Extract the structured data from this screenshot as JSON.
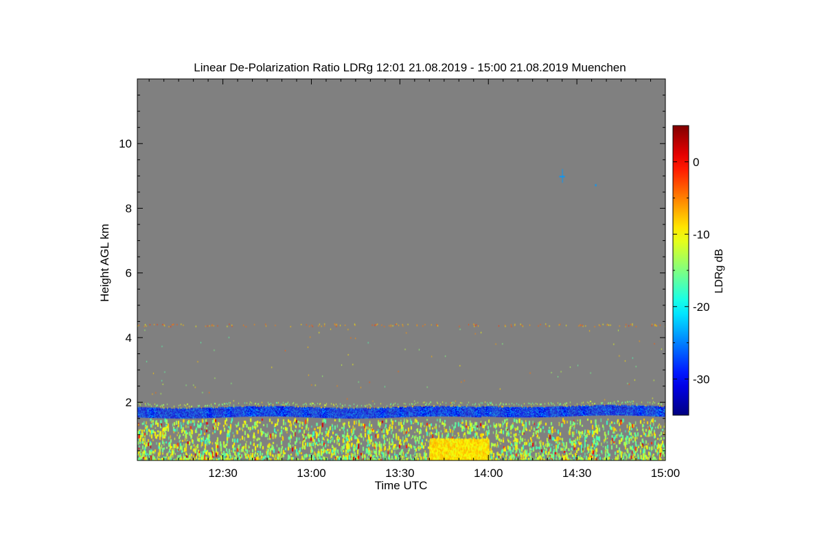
{
  "chart_data": {
    "type": "heatmap",
    "title": "Linear De-Polarization Ratio LDRg   12:01 21.08.2019 - 15:00 21.08.2019 Muenchen",
    "xlabel": "Time UTC",
    "ylabel": "Height AGL km",
    "x_range": [
      "12:01",
      "15:00"
    ],
    "x_ticks": [
      "12:30",
      "13:00",
      "13:30",
      "14:00",
      "14:30",
      "15:00"
    ],
    "y_range": [
      0.2,
      12.0
    ],
    "y_ticks": [
      "2",
      "4",
      "6",
      "8",
      "10"
    ],
    "colorbar": {
      "label": "LDRg dB",
      "range": [
        -35,
        5
      ],
      "ticks": [
        "0",
        "-10",
        "-20",
        "-30"
      ],
      "colormap": "jet"
    },
    "background_color": "#808080",
    "features": {
      "cloud_layer": {
        "base_km": 1.55,
        "top_km": 1.85,
        "ldr_db": -28
      },
      "boundary_layer": {
        "top_km": 1.5,
        "ldr_db": -13
      },
      "strong_echo_patch": {
        "time_start": "13:40",
        "time_end": "14:00",
        "top_km": 0.9,
        "ldr_db": -9
      },
      "sparse_echoes_km": 4.4,
      "isolated_echo": {
        "time": "14:25",
        "height_km": 9.0,
        "ldr_db": -24
      }
    }
  }
}
